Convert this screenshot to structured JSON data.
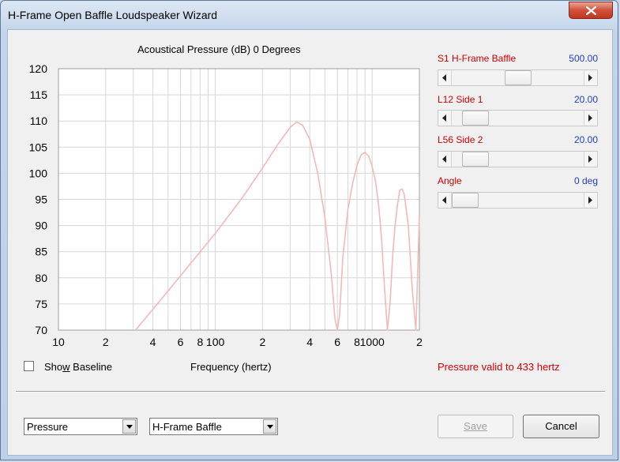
{
  "window": {
    "title": "H-Frame Open Baffle Loudspeaker Wizard"
  },
  "chart_data": {
    "type": "line",
    "title": "Acoustical Pressure (dB)   0 Degrees",
    "xlabel": "Frequency (hertz)",
    "ylabel": "",
    "x_scale": "log",
    "xlim": [
      10,
      2000
    ],
    "ylim": [
      70,
      120
    ],
    "y_ticks": [
      "120",
      "115",
      "110",
      "105",
      "100",
      "95",
      "90",
      "85",
      "80",
      "75",
      "70"
    ],
    "x_ticks": [
      {
        "value": 10,
        "label": "10"
      },
      {
        "value": 20,
        "label": "2"
      },
      {
        "value": 40,
        "label": "4"
      },
      {
        "value": 60,
        "label": "6"
      },
      {
        "value": 80,
        "label": "8"
      },
      {
        "value": 100,
        "label": "100"
      },
      {
        "value": 200,
        "label": "2"
      },
      {
        "value": 400,
        "label": "4"
      },
      {
        "value": 600,
        "label": "6"
      },
      {
        "value": 800,
        "label": "8"
      },
      {
        "value": 1000,
        "label": "1000"
      },
      {
        "value": 2000,
        "label": "2"
      }
    ],
    "grid": true,
    "line_color": "#f4b8b8",
    "series": [
      {
        "x": [
          31,
          50,
          100,
          150,
          200,
          250,
          300,
          330,
          360,
          400,
          450,
          500,
          550,
          580,
          600,
          620,
          650,
          700,
          750,
          800,
          850,
          900,
          950,
          1000,
          1050,
          1100,
          1150,
          1200,
          1250,
          1300,
          1350,
          1400,
          1450,
          1500,
          1550,
          1600,
          1700,
          1800,
          1900,
          2000
        ],
        "y": [
          70,
          77.5,
          88.5,
          95.5,
          101,
          105.5,
          108.8,
          109.8,
          109.2,
          106.5,
          100,
          91.5,
          80.5,
          72,
          70,
          73,
          84,
          93,
          98,
          101.5,
          103.5,
          104,
          103.3,
          101.3,
          98.5,
          94,
          87,
          78,
          70,
          75,
          84,
          90,
          94,
          96.8,
          97,
          96,
          90,
          78,
          70,
          92
        ]
      }
    ]
  },
  "controls": {
    "s1": {
      "label": "S1  H-Frame Baffle",
      "value": "500.00",
      "position": 0.5
    },
    "l12": {
      "label": "L12  Side 1",
      "value": "20.00",
      "position": 0.1
    },
    "l56": {
      "label": "L56  Side 2",
      "value": "20.00",
      "position": 0.1
    },
    "angle": {
      "label": "Angle",
      "value": "0 deg",
      "position": 0.0
    }
  },
  "show_baseline": {
    "label_pre": "Sho",
    "label_accel": "w",
    "label_post": " Baseline",
    "checked": false
  },
  "status": "Pressure valid to 433 hertz",
  "combo1": {
    "value": "Pressure"
  },
  "combo2": {
    "value": "H-Frame Baffle"
  },
  "buttons": {
    "save": "Save",
    "cancel": "Cancel"
  }
}
